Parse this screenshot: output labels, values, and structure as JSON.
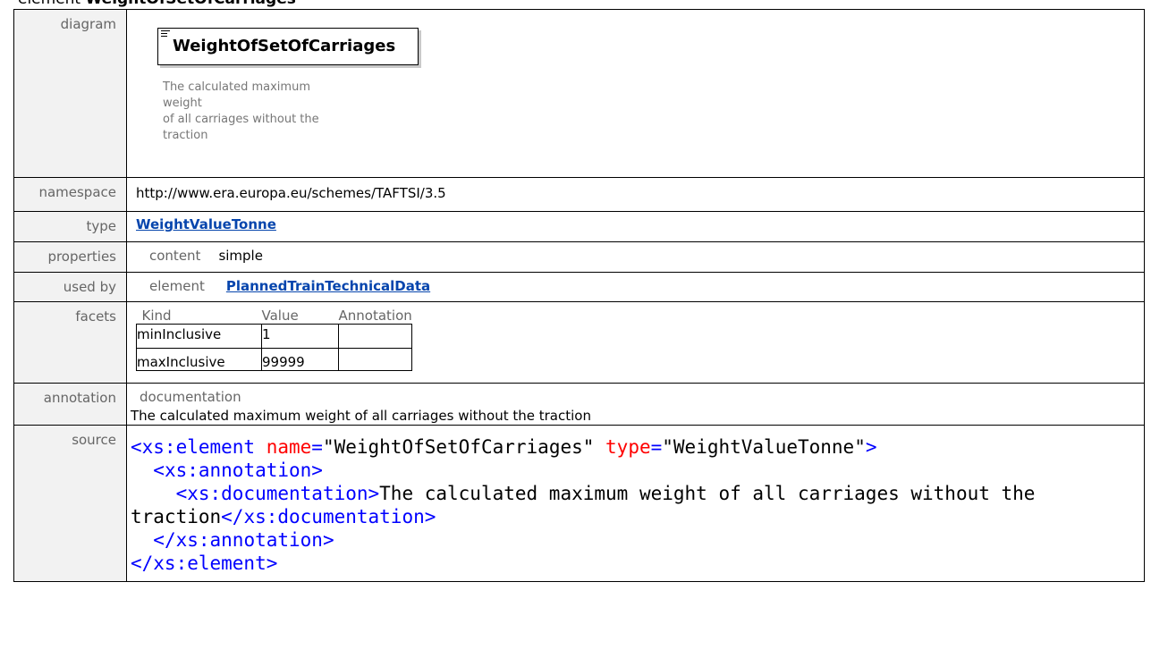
{
  "page_title": {
    "prefix": "element ",
    "name": "WeightOfSetOfCarriages"
  },
  "rows": {
    "diagram": {
      "label": "diagram",
      "element_name": "WeightOfSetOfCarriages",
      "doc_line1": "The calculated maximum weight",
      "doc_line2": "of all carriages without the",
      "doc_line3": "traction"
    },
    "namespace": {
      "label": "namespace",
      "value": "http://www.era.europa.eu/schemes/TAFTSI/3.5"
    },
    "type": {
      "label": "type",
      "value": "WeightValueTonne"
    },
    "properties": {
      "label": "properties",
      "key": "content",
      "value": "simple"
    },
    "used_by": {
      "label": "used by",
      "key": "element",
      "value": "PlannedTrainTechnicalData"
    },
    "facets": {
      "label": "facets",
      "headers": [
        "Kind",
        "Value",
        "Annotation"
      ],
      "rows": [
        {
          "kind": "minInclusive",
          "value": "1",
          "annotation": ""
        },
        {
          "kind": "maxInclusive",
          "value": "99999",
          "annotation": ""
        }
      ]
    },
    "annotation": {
      "label": "annotation",
      "heading": "documentation",
      "text": "The calculated maximum weight of all carriages without the traction"
    },
    "source": {
      "label": "source",
      "lines": {
        "l1_open": "<xs:element",
        "l1_attr1": " name",
        "l1_eq1": "=",
        "l1_q1": "\"WeightOfSetOfCarriages\"",
        "l1_attr2": " type",
        "l1_eq2": "=",
        "l1_q2": "\"WeightValueTonne\"",
        "l1_close": ">",
        "l2": "  <xs:annotation>",
        "l3_open": "    <xs:documentation>",
        "l3_text": "The calculated maximum weight of all carriages without the traction",
        "l3_close": "</xs:documentation>",
        "l4": "  </xs:annotation>",
        "l5": "</xs:element>"
      }
    }
  }
}
